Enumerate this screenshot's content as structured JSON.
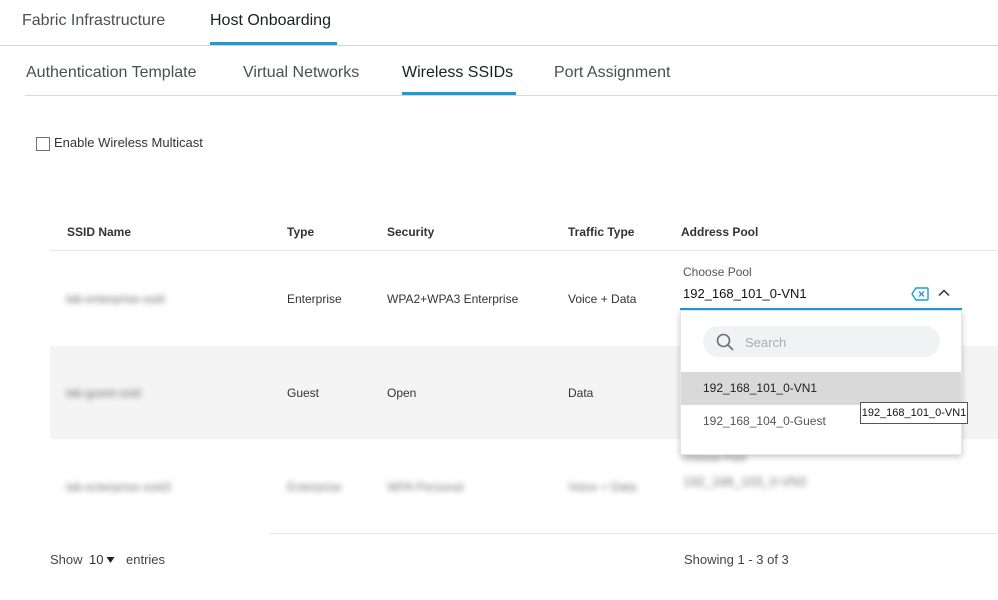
{
  "top_tabs": [
    {
      "label": "Fabric Infrastructure",
      "active": false
    },
    {
      "label": "Host Onboarding",
      "active": true
    }
  ],
  "sub_tabs": [
    {
      "label": "Authentication Template",
      "active": false
    },
    {
      "label": "Virtual Networks",
      "active": false
    },
    {
      "label": "Wireless SSIDs",
      "active": true
    },
    {
      "label": "Port Assignment",
      "active": false
    }
  ],
  "multicast": {
    "label": "Enable Wireless Multicast",
    "checked": false
  },
  "table": {
    "columns": [
      "SSID Name",
      "Type",
      "Security",
      "Traffic Type",
      "Address Pool"
    ],
    "rows": [
      {
        "ssid": "lab-enterprise-ssid",
        "type": "Enterprise",
        "security": "WPA2+WPA3 Enterprise",
        "traffic": "Voice + Data"
      },
      {
        "ssid": "lab-guest-ssid",
        "type": "Guest",
        "security": "Open",
        "traffic": "Data"
      },
      {
        "ssid": "lab-enterprise-ssid2",
        "type": "Enterprise",
        "security": "WPA Personal",
        "traffic": "Voice + Data",
        "pool_label": "Choose Pool",
        "pool_value": "192_168_103_0-VN2"
      }
    ]
  },
  "pool_select": {
    "label": "Choose Pool",
    "value": "192_168_101_0-VN1",
    "search_placeholder": "Search",
    "options": [
      "192_168_101_0-VN1",
      "192_168_104_0-Guest"
    ],
    "tooltip": "192_168_101_0-VN1"
  },
  "footer": {
    "show": "Show",
    "entries_value": "10",
    "entries": "entries",
    "showing": "Showing 1 - 3 of 3"
  },
  "colors": {
    "accent": "#1e9bd7",
    "selected_option": "#d9d9d9"
  },
  "icons": [
    "search-icon",
    "clear-icon",
    "chevron-up-icon",
    "caret-down-icon"
  ]
}
